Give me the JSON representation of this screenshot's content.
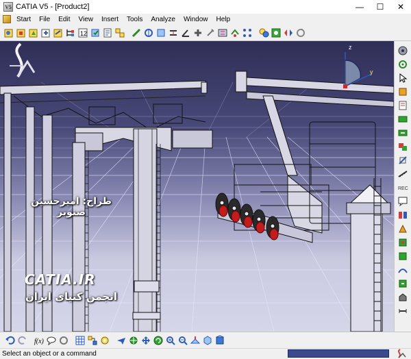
{
  "window": {
    "title": "CATIA V5 - [Product2]",
    "app_icon_text": "V5"
  },
  "menu": {
    "items": [
      {
        "label": "Start",
        "access": "S"
      },
      {
        "label": "File",
        "access": "F"
      },
      {
        "label": "Edit",
        "access": "E"
      },
      {
        "label": "View",
        "access": "V"
      },
      {
        "label": "Insert",
        "access": "I"
      },
      {
        "label": "Tools",
        "access": "T"
      },
      {
        "label": "Analyze",
        "access": "A"
      },
      {
        "label": "Window",
        "access": "W"
      },
      {
        "label": "Help",
        "access": "H"
      }
    ]
  },
  "viewport": {
    "designer_text": "طراح: امیرحسین صنوبر",
    "logo_text": "CATIA.IR",
    "forum_text": "انجمن کتیای ایران",
    "compass": {
      "z": "z",
      "y": "y"
    }
  },
  "status": {
    "prompt": "Select an object or a command"
  },
  "colors": {
    "accent": "#3a4a8c",
    "sky_top": "#2e2e56",
    "sky_bottom": "#d6d6ea",
    "structure": "#d8d8e4",
    "wheel_red": "#c41c1c"
  }
}
